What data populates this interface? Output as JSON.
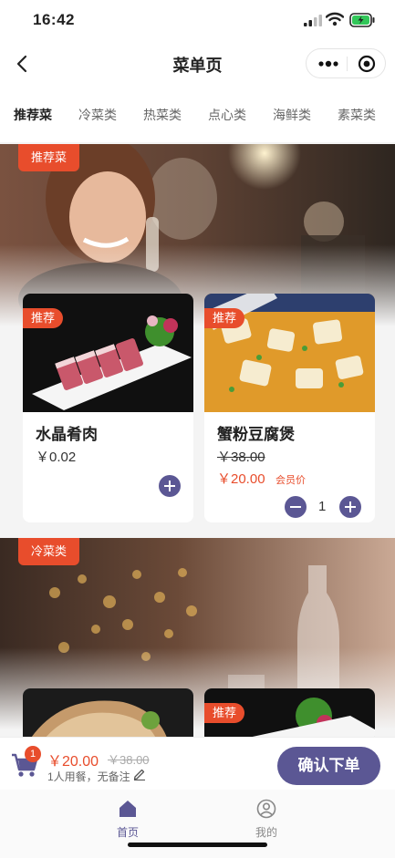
{
  "status_bar": {
    "time": "16:42"
  },
  "nav": {
    "title": "菜单页"
  },
  "tabs": [
    {
      "label": "推荐菜",
      "active": true
    },
    {
      "label": "冷菜类",
      "active": false
    },
    {
      "label": "热菜类",
      "active": false
    },
    {
      "label": "点心类",
      "active": false
    },
    {
      "label": "海鲜类",
      "active": false
    },
    {
      "label": "素菜类",
      "active": false
    }
  ],
  "sections": [
    {
      "tag": "推荐菜",
      "dishes": [
        {
          "badge": "推荐",
          "name": "水晶肴肉",
          "price": "￥0.02"
        },
        {
          "badge": "推荐",
          "name": "蟹粉豆腐煲",
          "original_price": "￥38.00",
          "member_price": "￥20.00",
          "member_label": "会员价",
          "quantity": "1"
        }
      ]
    },
    {
      "tag": "冷菜类",
      "dishes": [
        {
          "badge": ""
        },
        {
          "badge": "推荐"
        }
      ]
    }
  ],
  "cart": {
    "count": "1",
    "total": "￥20.00",
    "original_total": "￥38.00",
    "note": "1人用餐，无备注",
    "confirm_label": "确认下单"
  },
  "tabbar": [
    {
      "label": "首页",
      "active": true
    },
    {
      "label": "我的",
      "active": false
    }
  ],
  "colors": {
    "accent": "#e84d2c",
    "primary": "#5b5794",
    "background": "#f4f4f4"
  }
}
